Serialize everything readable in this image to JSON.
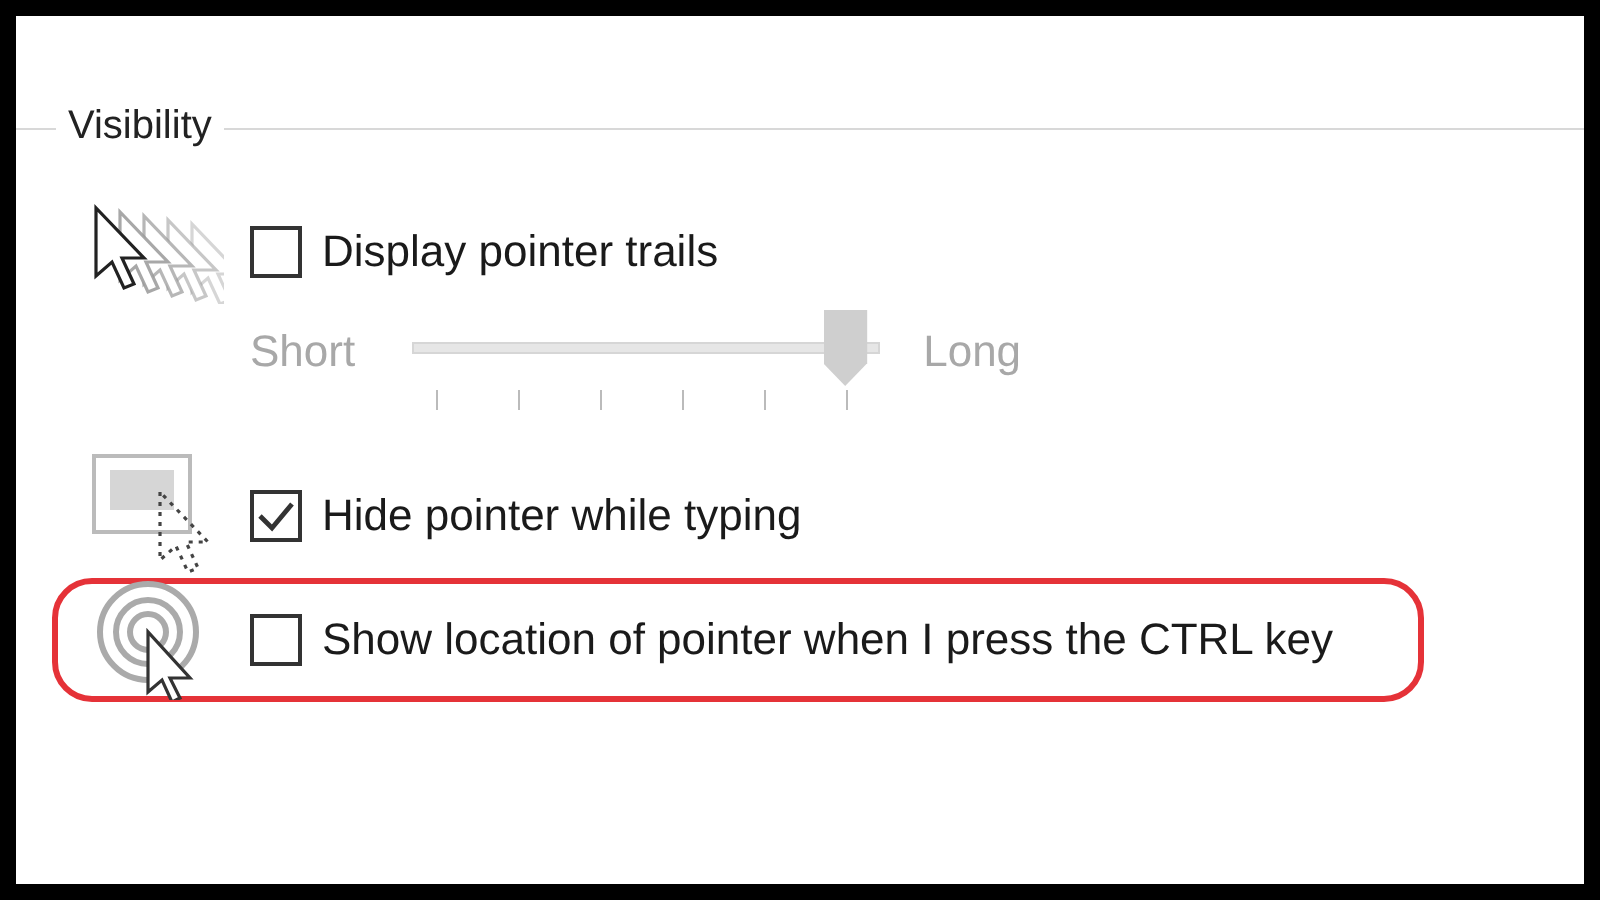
{
  "group": {
    "title": "Visibility"
  },
  "rows": [
    {
      "kind": "checkbox",
      "label": "Display pointer trails",
      "checked": false
    },
    {
      "kind": "slider",
      "min_label": "Short",
      "max_label": "Long",
      "level": 1,
      "disabled": true
    },
    {
      "kind": "checkbox",
      "label": "Hide pointer while typing",
      "checked": true
    },
    {
      "kind": "checkbox",
      "label": "Show location of pointer when I press the CTRL key",
      "checked": false,
      "highlighted": true
    }
  ]
}
